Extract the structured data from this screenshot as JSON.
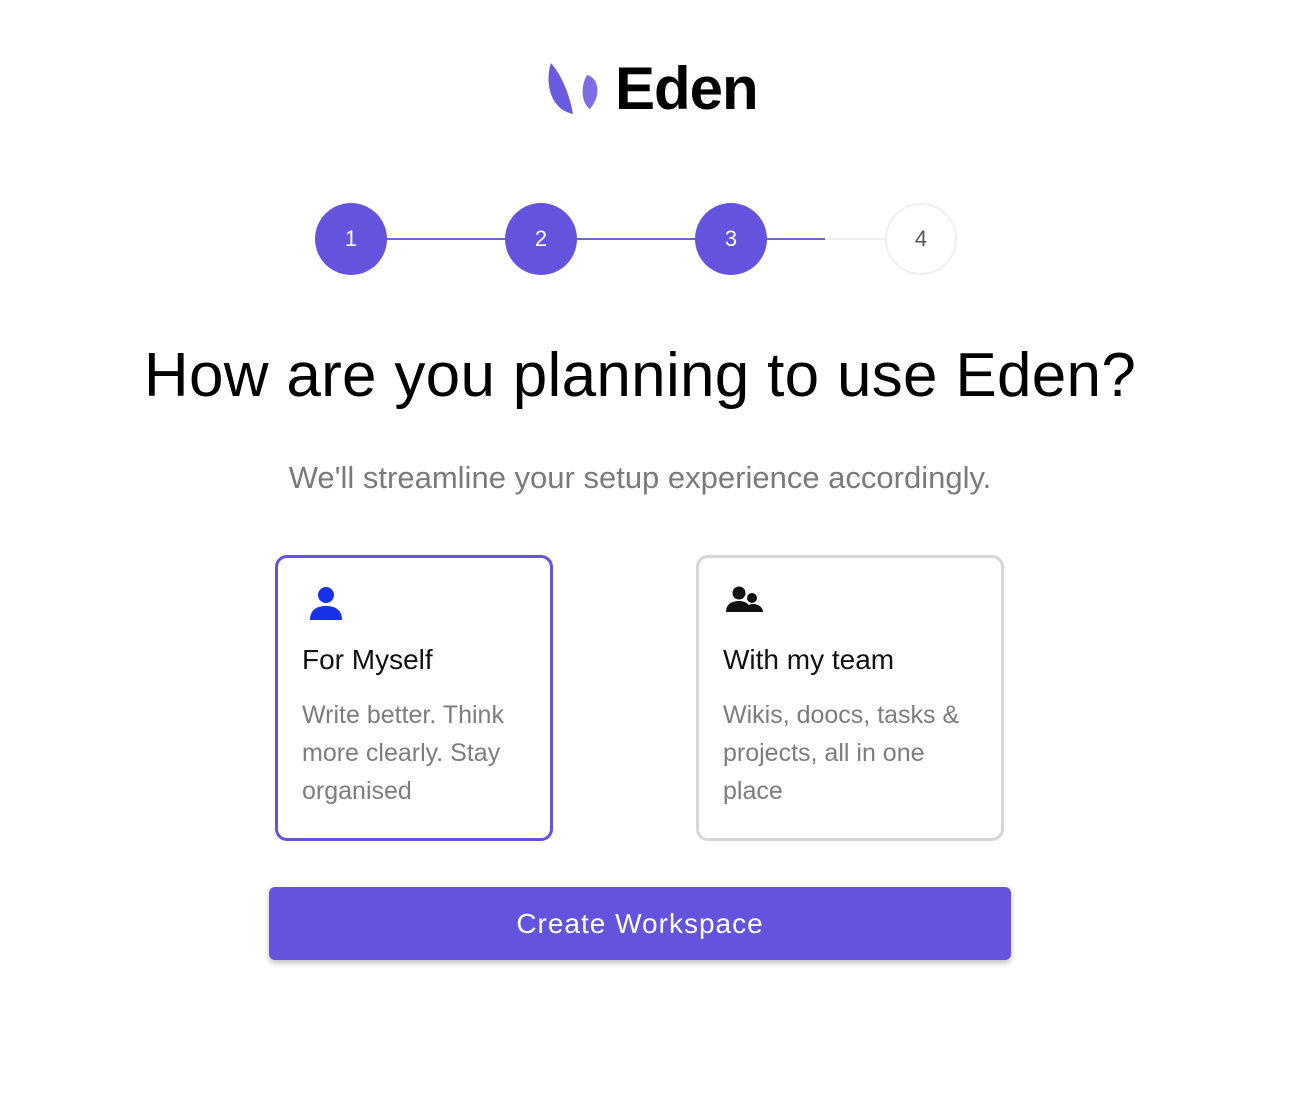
{
  "brand": {
    "name": "Eden",
    "accent_color": "#6353dd"
  },
  "stepper": {
    "current_step": 3,
    "steps": [
      {
        "label": "1",
        "status": "completed"
      },
      {
        "label": "2",
        "status": "completed"
      },
      {
        "label": "3",
        "status": "completed"
      },
      {
        "label": "4",
        "status": "pending"
      }
    ]
  },
  "main": {
    "title": "How are you planning to use Eden?",
    "subtitle": "We'll streamline your setup experience accordingly."
  },
  "options": [
    {
      "icon": "person-icon",
      "title": "For Myself",
      "description": "Write better. Think more clearly. Stay organised",
      "selected": true
    },
    {
      "icon": "group-icon",
      "title": "With my team",
      "description": "Wikis, doocs, tasks & projects, all in one place",
      "selected": false
    }
  ],
  "actions": {
    "create_label": "Create Workspace"
  }
}
